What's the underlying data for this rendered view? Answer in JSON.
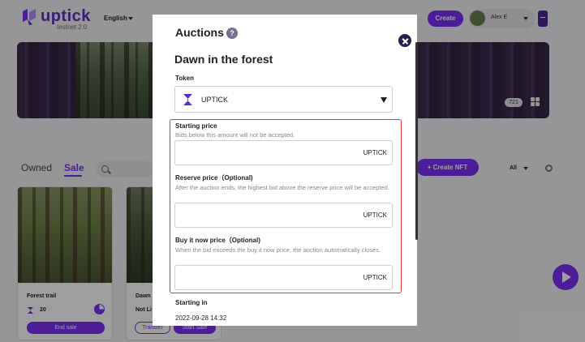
{
  "header": {
    "brand": "uptick",
    "brand_sub": "testnet 2.0",
    "language": "English",
    "create_label": "Create",
    "user_name": "Alex E"
  },
  "banner": {
    "count_badge": "721"
  },
  "tabs": {
    "owned": "Owned",
    "sale": "Sale",
    "active": "Sale"
  },
  "toolbar": {
    "create_nft_label": "+ Create NFT",
    "filter_label": "All"
  },
  "cards": [
    {
      "title": "Forest trail",
      "price": "20",
      "action_label": "End sale"
    },
    {
      "title": "Dawn i",
      "status": "Not Li",
      "transfer_label": "Transfer",
      "start_sale_label": "Start Sale"
    }
  ],
  "modal": {
    "title": "Auctions",
    "help_symbol": "?",
    "nft_name": "Dawn in the forest",
    "token_label": "Token",
    "token_value": "UPTICK",
    "starting_price": {
      "label": "Starting price",
      "help": "Bids below this amount will not be accepted.",
      "value": "",
      "unit": "UPTICK"
    },
    "reserve_price": {
      "label": "Reserve price（Optional)",
      "help": "After the auction ends, the highest bid above the reserve price will be accepted.",
      "value": "",
      "unit": "UPTICK"
    },
    "buy_now_price": {
      "label": "Buy it now price（Optional)",
      "help": "When the bid exceeds the buy it now price, the auction automatically closes.",
      "value": "",
      "unit": "UPTICK"
    },
    "starting_in": {
      "label": "Starting in",
      "value": "2022-09-28 14:32"
    }
  },
  "icons": {
    "logo": "uptick-logo-icon",
    "search": "search-icon",
    "grid": "grid-view-icon",
    "refresh": "refresh-icon",
    "close": "close-icon",
    "help": "help-icon",
    "token": "uptick-token-icon",
    "dropdown": "caret-down-icon",
    "play": "play-icon",
    "wallet": "wallet-icon"
  },
  "colors": {
    "accent": "#7b2ff7",
    "brand": "#5b2ec4",
    "highlight_border": "#e53030",
    "overlay": "rgba(0,0,0,0.38)"
  }
}
